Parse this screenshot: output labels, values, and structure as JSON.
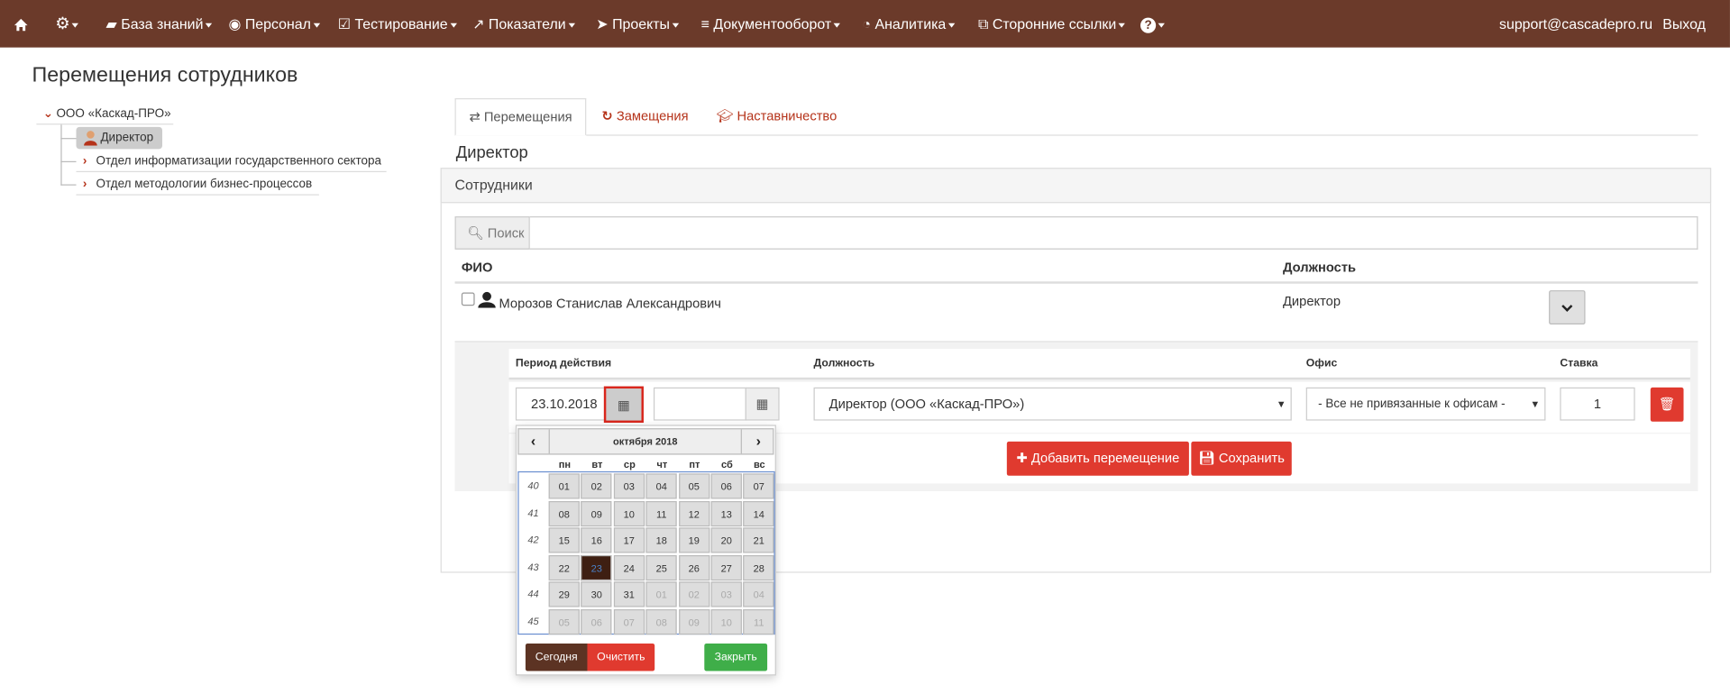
{
  "navbar": {
    "items": [
      {
        "icon": "home-icon",
        "label": ""
      },
      {
        "icon": "gear-icon",
        "label": ""
      },
      {
        "icon": "book-icon",
        "label": "База знаний"
      },
      {
        "icon": "user-circle-icon",
        "label": "Персонал"
      },
      {
        "icon": "checkbox-icon",
        "label": "Тестирование"
      },
      {
        "icon": "line-chart-icon",
        "label": "Показатели"
      },
      {
        "icon": "send-icon",
        "label": "Проекты"
      },
      {
        "icon": "server-icon",
        "label": "Документооборот"
      },
      {
        "icon": "pie-chart-icon",
        "label": "Аналитика"
      },
      {
        "icon": "external-link-icon",
        "label": "Сторонние ссылки"
      },
      {
        "icon": "question-icon",
        "label": ""
      }
    ],
    "user": "support@cascadepro.ru",
    "logout": "Выход",
    "bg": "#6b3a2a"
  },
  "page_title": "Перемещения сотрудников",
  "tree": {
    "root": "ООО «Каскад-ПРО»",
    "selected": "Директор",
    "children": [
      "Отдел информатизации государственного сектора",
      "Отдел методологии бизнес-процессов"
    ]
  },
  "tabs": [
    {
      "label": "Перемещения",
      "icon": "exchange-icon",
      "active": true
    },
    {
      "label": "Замещения",
      "icon": "refresh-icon",
      "active": false
    },
    {
      "label": "Наставничество",
      "icon": "graduation-cap-icon",
      "active": false
    }
  ],
  "section_title": "Директор",
  "panel_title": "Сотрудники",
  "search": {
    "placeholder": "Поиск",
    "value": ""
  },
  "table": {
    "headers": {
      "fio": "ФИО",
      "position": "Должность"
    },
    "row": {
      "name": "Морозов Станислав Александрович",
      "position": "Директор"
    }
  },
  "detail": {
    "headers": {
      "period": "Период действия",
      "position": "Должность",
      "office": "Офис",
      "rate": "Ставка"
    },
    "date_from": "23.10.2018",
    "date_to": "",
    "position_value": "Директор (ООО «Каскад-ПРО»)",
    "office_value": "- Все не привязанные к офисам -",
    "rate_value": "1",
    "add_button": "Добавить перемещение",
    "save_button": "Сохранить"
  },
  "calendar": {
    "month": "октября 2018",
    "weekdays": [
      "пн",
      "вт",
      "ср",
      "чт",
      "пт",
      "сб",
      "вс"
    ],
    "weeks": [
      {
        "n": "40",
        "days": [
          "01",
          "02",
          "03",
          "04",
          "05",
          "06",
          "07"
        ]
      },
      {
        "n": "41",
        "days": [
          "08",
          "09",
          "10",
          "11",
          "12",
          "13",
          "14"
        ]
      },
      {
        "n": "42",
        "days": [
          "15",
          "16",
          "17",
          "18",
          "19",
          "20",
          "21"
        ]
      },
      {
        "n": "43",
        "days": [
          "22",
          "23",
          "24",
          "25",
          "26",
          "27",
          "28"
        ]
      },
      {
        "n": "44",
        "days": [
          "29",
          "30",
          "31",
          "01",
          "02",
          "03",
          "04"
        ]
      },
      {
        "n": "45",
        "days": [
          "05",
          "06",
          "07",
          "08",
          "09",
          "10",
          "11"
        ]
      }
    ],
    "selected_day": "23",
    "today_button": "Сегодня",
    "clear_button": "Очистить",
    "close_button": "Закрыть"
  }
}
